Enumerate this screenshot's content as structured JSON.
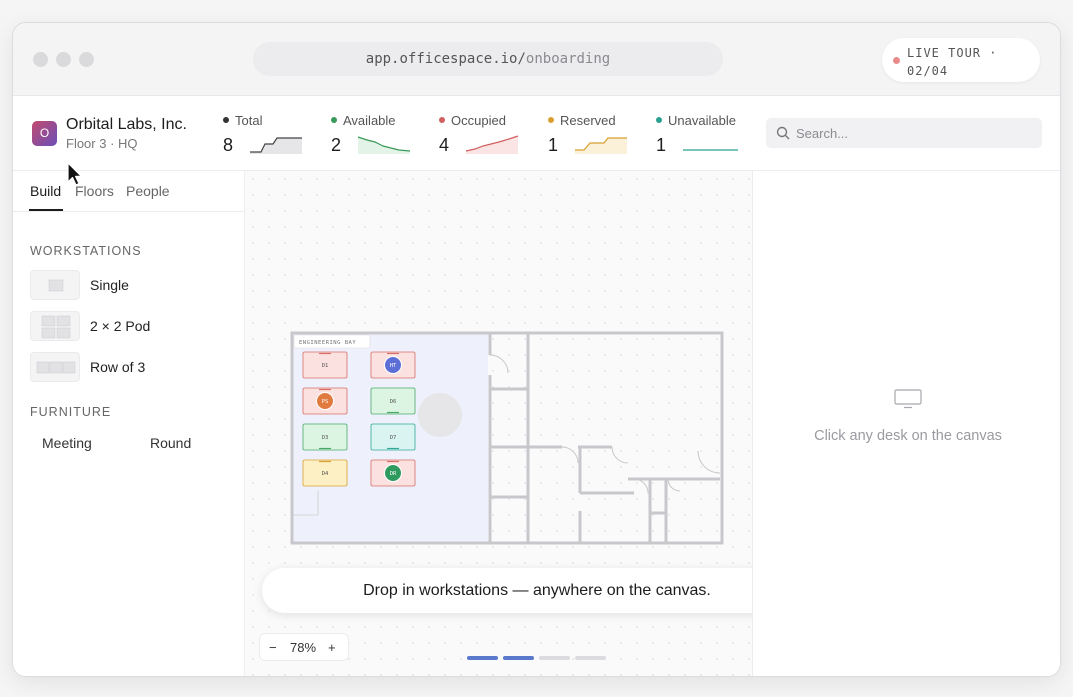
{
  "browser": {
    "url_host": "app.officespace.io/",
    "url_path": "onboarding",
    "live_tour_label": "LIVE TOUR ·",
    "live_tour_step": "02/04"
  },
  "org": {
    "logo_letter": "O",
    "name": "Orbital Labs, Inc.",
    "floor": "Floor 3 · HQ"
  },
  "stats": [
    {
      "label": "Total",
      "value": "8",
      "color": "#333333"
    },
    {
      "label": "Available",
      "value": "2",
      "color": "#3a9a5a"
    },
    {
      "label": "Occupied",
      "value": "4",
      "color": "#d06060"
    },
    {
      "label": "Reserved",
      "value": "1",
      "color": "#d8a030"
    },
    {
      "label": "Unavailable",
      "value": "1",
      "color": "#2aa090"
    }
  ],
  "search": {
    "placeholder": "Search..."
  },
  "tabs": [
    "Build",
    "Floors",
    "People"
  ],
  "left": {
    "workstations_heading": "WORKSTATIONS",
    "workstations": [
      "Single",
      "2 × 2 Pod",
      "Row of 3"
    ],
    "furniture_heading": "FURNITURE",
    "furniture": [
      "Meeting",
      "Round"
    ]
  },
  "plan": {
    "zone_label": "ENGINEERING BAY",
    "desks": [
      {
        "label": "D1",
        "status": "occupied"
      },
      {
        "label": "HT",
        "status": "occupied",
        "avatar": true,
        "avatar_color": "#5b6fd6"
      },
      {
        "label": "PS",
        "status": "occupied",
        "avatar": true,
        "avatar_color": "#e07a3e"
      },
      {
        "label": "D6",
        "status": "available"
      },
      {
        "label": "D3",
        "status": "available"
      },
      {
        "label": "D7",
        "status": "unavailable"
      },
      {
        "label": "D4",
        "status": "reserved"
      },
      {
        "label": "DR",
        "status": "occupied",
        "avatar": true,
        "avatar_color": "#2e9a5e"
      }
    ]
  },
  "canvas": {
    "toast": "Drop in workstations — anywhere on the canvas.",
    "zoom_out": "−",
    "zoom_level": "78%",
    "zoom_in": "+",
    "steps_done": 2,
    "steps_total": 4
  },
  "right_panel": {
    "icon": "monitor-icon",
    "empty_text": "Click any desk on the canvas"
  }
}
